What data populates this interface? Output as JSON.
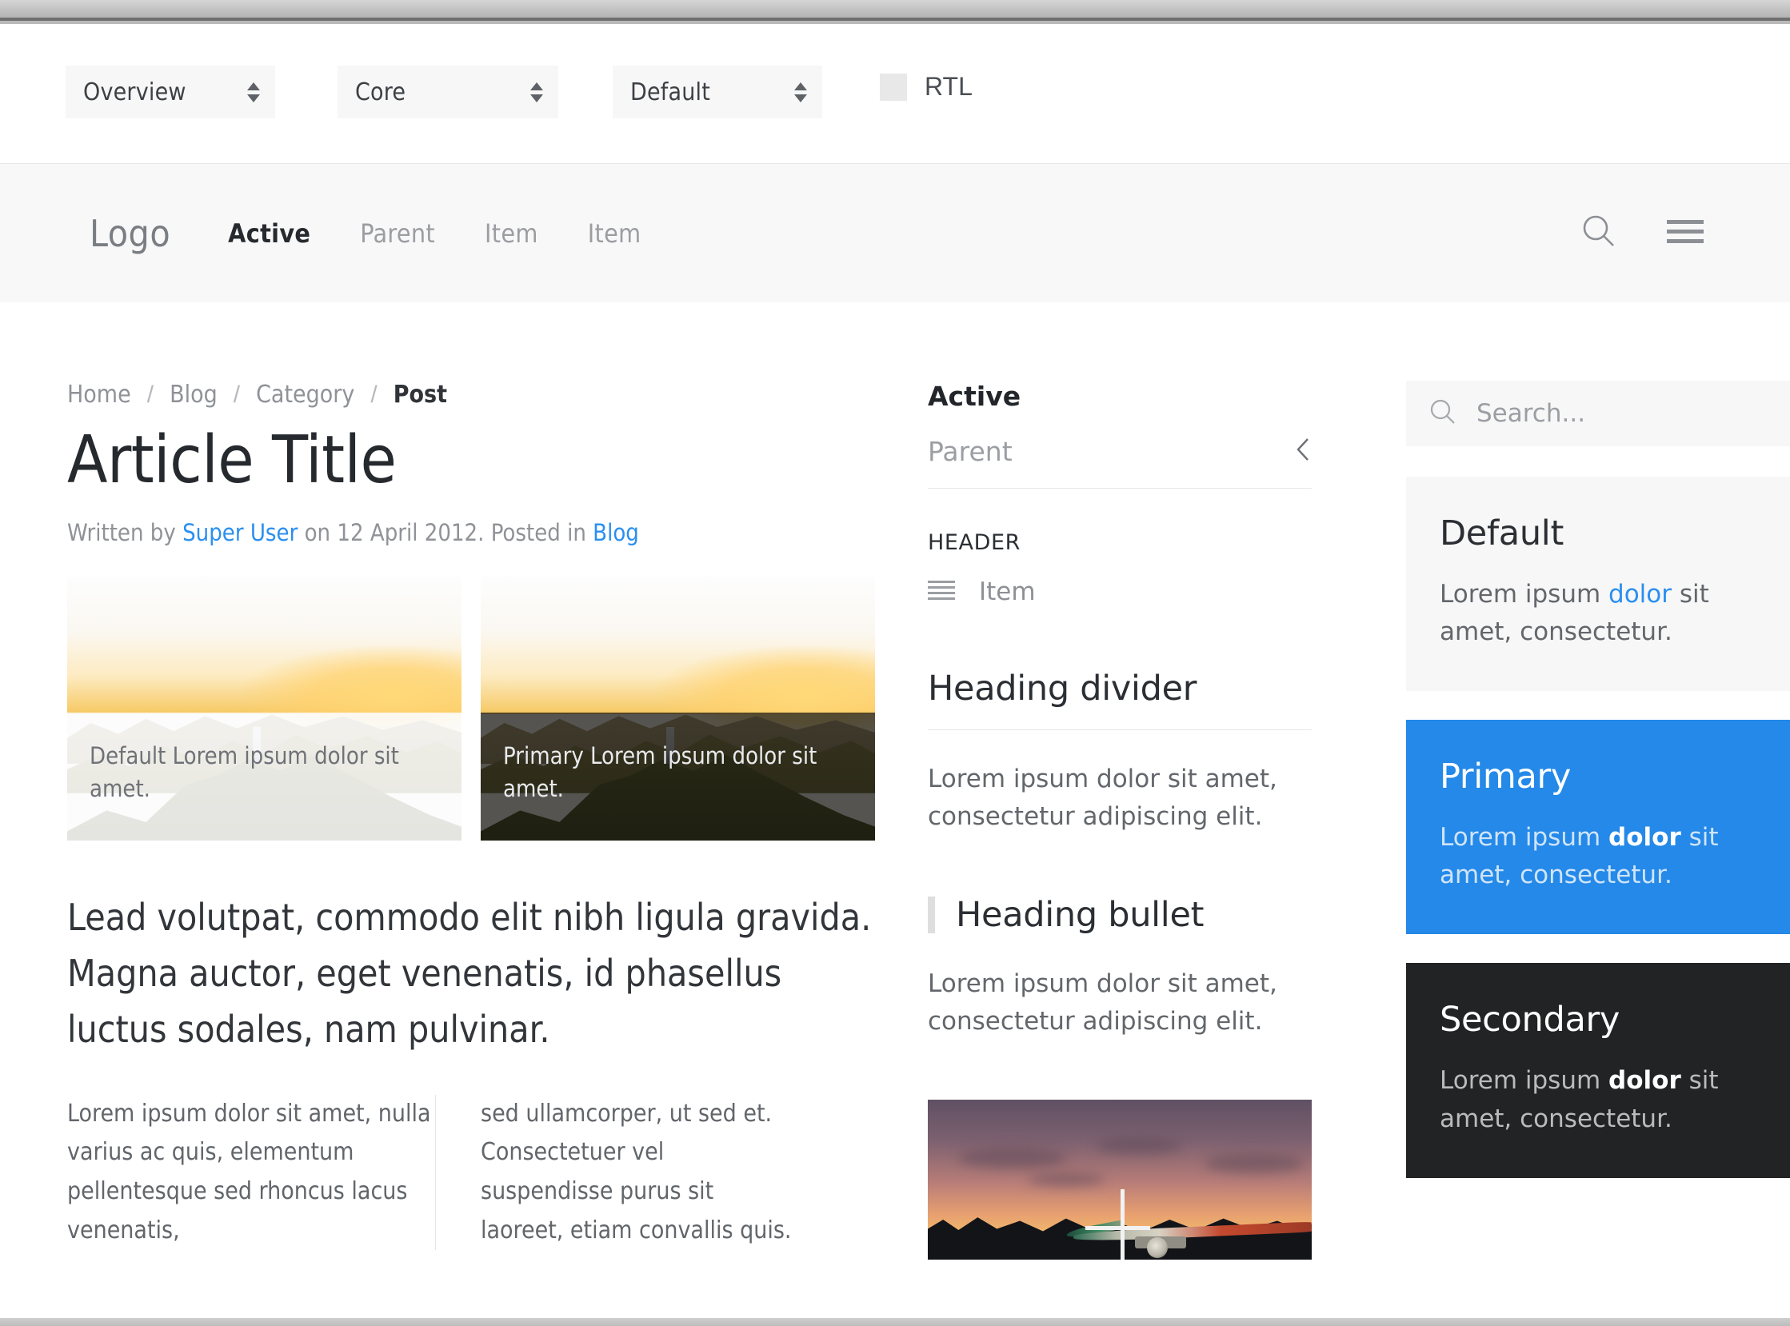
{
  "toolbar": {
    "selects": [
      {
        "name": "overview",
        "value": "Overview"
      },
      {
        "name": "core",
        "value": "Core"
      },
      {
        "name": "default",
        "value": "Default"
      }
    ],
    "rtl_label": "RTL",
    "rtl_checked": false
  },
  "navbar": {
    "logo": "Logo",
    "items": [
      {
        "label": "Active",
        "active": true
      },
      {
        "label": "Parent",
        "active": false
      },
      {
        "label": "Item",
        "active": false
      },
      {
        "label": "Item",
        "active": false
      }
    ],
    "search_icon": "search-icon",
    "menu_icon": "hamburger-menu-icon"
  },
  "article": {
    "breadcrumb": [
      {
        "label": "Home",
        "current": false
      },
      {
        "label": "Blog",
        "current": false
      },
      {
        "label": "Category",
        "current": false
      },
      {
        "label": "Post",
        "current": true
      }
    ],
    "breadcrumb_separator": "/",
    "title": "Article Title",
    "meta": {
      "written_by_prefix": "Written by ",
      "author": "Super User",
      "date_part": " on 12 April 2012. Posted in ",
      "category": "Blog"
    },
    "media": [
      {
        "variant": "default",
        "caption": "Default Lorem ipsum dolor sit amet."
      },
      {
        "variant": "primary",
        "caption": "Primary Lorem ipsum dolor sit amet."
      }
    ],
    "lead": "Lead volutpat, commodo elit nibh ligula gravida. Magna auctor, eget venenatis, id phasellus luctus sodales, nam pulvinar.",
    "columns": [
      "Lorem ipsum dolor sit amet, nulla varius ac quis, elementum pellentesque sed rhoncus lacus venenatis,",
      "sed ullamcorper, ut sed et. Consectetuer vel suspendisse purus sit laoreet, etiam convallis quis."
    ]
  },
  "middle": {
    "nav_active": "Active",
    "nav_parent": "Parent",
    "nav_parent_icon": "chevron-left-icon",
    "header_title": "HEADER",
    "item_icon": "list-icon",
    "item_label": "Item",
    "heading_divider": "Heading divider",
    "divider_body": "Lorem ipsum dolor sit amet, consectetur adipiscing elit.",
    "heading_bullet": "Heading bullet",
    "bullet_body": "Lorem ipsum dolor sit amet, consectetur adipiscing elit.",
    "photo_alt": "sunset-skateboard-photo"
  },
  "sidebar": {
    "search": {
      "icon": "search-icon",
      "placeholder": "Search...",
      "value": ""
    },
    "cards": [
      {
        "variant": "default",
        "title": "Default",
        "body_pre": "Lorem ipsum ",
        "body_link": "dolor",
        "body_post": " sit amet, consectetur."
      },
      {
        "variant": "primary",
        "title": "Primary",
        "body_pre": "Lorem ipsum ",
        "body_link": "dolor",
        "body_post": " sit amet, consectetur."
      },
      {
        "variant": "secondary",
        "title": "Secondary",
        "body_pre": "Lorem ipsum ",
        "body_link": "dolor",
        "body_post": " sit amet, consectetur."
      }
    ]
  },
  "colors": {
    "primary": "#2489e8",
    "secondary": "#222324",
    "link": "#2a8ff0",
    "muted_bg": "#f7f7f7",
    "navbar_bg": "#f8f8f8"
  }
}
